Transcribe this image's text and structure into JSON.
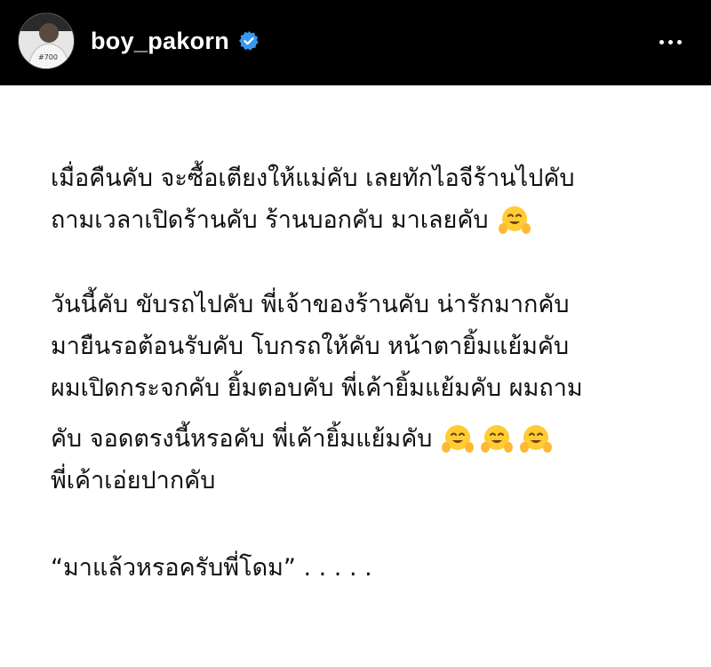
{
  "header": {
    "username": "boy_pakorn",
    "verified": true,
    "avatar_text": "#700"
  },
  "post": {
    "paragraphs": [
      [
        "เมื่อคืนคับ จะซื้อเตียงให้แม่คับ เลยทักไอจีร้านไปคับ",
        "ถามเวลาเปิดร้านคับ ร้านบอกคับ มาเลยคับ"
      ],
      [
        "วันนี้คับ ขับรถไปคับ พี่เจ้าของร้านคับ น่ารักมากคับ",
        "มายืนรอต้อนรับคับ โบกรถให้คับ หน้าตายิ้มแย้มคับ",
        "ผมเปิดกระจกคับ ยิ้มตอบคับ พี่เค้ายิ้มแย้มคับ ผมถาม",
        "คับ จอดตรงนี้หรอคับ พี่เค้ายิ้มแย้มคับ",
        "พี่เค้าเอ่ยปากคับ"
      ],
      [
        "“มาแล้วหรอครับพี่โดม” . . . . ."
      ]
    ],
    "emoji_name": "hugging-face-emoji"
  },
  "colors": {
    "header_bg": "#000000",
    "username": "#ffffff",
    "verified_badge": "#3897f0",
    "body_bg": "#ffffff",
    "text": "#111111",
    "emoji": "#ffcc33"
  }
}
